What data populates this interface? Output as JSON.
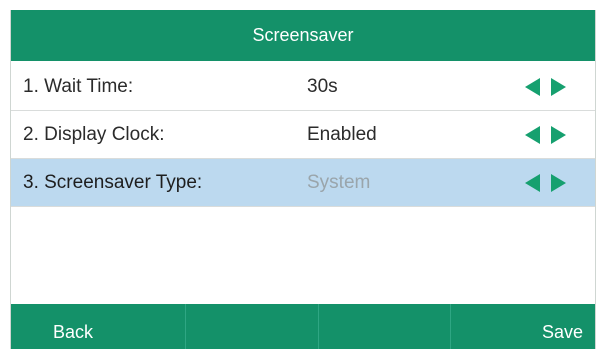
{
  "header": {
    "title": "Screensaver"
  },
  "settings": [
    {
      "label": "1. Wait Time:",
      "value": "30s",
      "selected": false
    },
    {
      "label": "2. Display Clock:",
      "value": "Enabled",
      "selected": false
    },
    {
      "label": "3. Screensaver Type:",
      "value": "System",
      "selected": true
    }
  ],
  "softkeys": [
    {
      "label": "Back"
    },
    {
      "label": ""
    },
    {
      "label": ""
    },
    {
      "label": "Save"
    }
  ],
  "icons": {
    "left_arrow": "left-triangle-icon",
    "right_arrow": "right-triangle-icon"
  },
  "colors": {
    "header_bg": "#149169",
    "selected_row_bg": "#bcd9ef",
    "arrow_green": "#16a06f"
  }
}
